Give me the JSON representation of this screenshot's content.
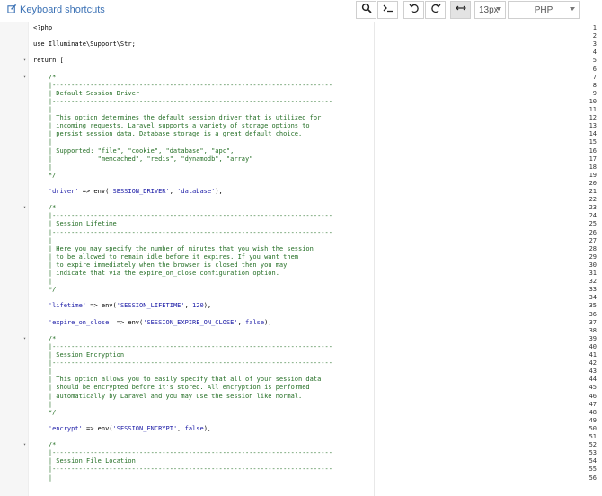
{
  "toolbar": {
    "keyboard_shortcuts": "Keyboard shortcuts",
    "font_size": "13px",
    "mode": "PHP"
  },
  "editor": {
    "lines": [
      {
        "n": "1",
        "text": "<?php",
        "cls": "kw"
      },
      {
        "n": "2",
        "text": "",
        "cls": ""
      },
      {
        "n": "3",
        "text": "use Illuminate\\Support\\Str;",
        "cls": "kw"
      },
      {
        "n": "4",
        "text": "",
        "cls": ""
      },
      {
        "n": "5",
        "text": "return [",
        "cls": "kw",
        "fold": true
      },
      {
        "n": "6",
        "text": "",
        "cls": ""
      },
      {
        "n": "7",
        "text": "    /*",
        "cls": "cmt",
        "fold": true
      },
      {
        "n": "8",
        "text": "    |--------------------------------------------------------------------------",
        "cls": "cmt"
      },
      {
        "n": "9",
        "text": "    | Default Session Driver",
        "cls": "cmt"
      },
      {
        "n": "10",
        "text": "    |--------------------------------------------------------------------------",
        "cls": "cmt"
      },
      {
        "n": "11",
        "text": "    |",
        "cls": "cmt"
      },
      {
        "n": "12",
        "text": "    | This option determines the default session driver that is utilized for",
        "cls": "cmt"
      },
      {
        "n": "13",
        "text": "    | incoming requests. Laravel supports a variety of storage options to",
        "cls": "cmt"
      },
      {
        "n": "14",
        "text": "    | persist session data. Database storage is a great default choice.",
        "cls": "cmt"
      },
      {
        "n": "15",
        "text": "    |",
        "cls": "cmt"
      },
      {
        "n": "16",
        "text": "    | Supported: \"file\", \"cookie\", \"database\", \"apc\",",
        "cls": "cmt"
      },
      {
        "n": "17",
        "text": "    |            \"memcached\", \"redis\", \"dynamodb\", \"array\"",
        "cls": "cmt"
      },
      {
        "n": "18",
        "text": "    |",
        "cls": "cmt"
      },
      {
        "n": "19",
        "text": "    */",
        "cls": "cmt"
      },
      {
        "n": "20",
        "text": "",
        "cls": ""
      },
      {
        "n": "21",
        "text": "    'driver' => env('SESSION_DRIVER', 'database'),",
        "cls": "mix"
      },
      {
        "n": "22",
        "text": "",
        "cls": ""
      },
      {
        "n": "23",
        "text": "    /*",
        "cls": "cmt",
        "fold": true
      },
      {
        "n": "24",
        "text": "    |--------------------------------------------------------------------------",
        "cls": "cmt"
      },
      {
        "n": "25",
        "text": "    | Session Lifetime",
        "cls": "cmt"
      },
      {
        "n": "26",
        "text": "    |--------------------------------------------------------------------------",
        "cls": "cmt"
      },
      {
        "n": "27",
        "text": "    |",
        "cls": "cmt"
      },
      {
        "n": "28",
        "text": "    | Here you may specify the number of minutes that you wish the session",
        "cls": "cmt"
      },
      {
        "n": "29",
        "text": "    | to be allowed to remain idle before it expires. If you want them",
        "cls": "cmt"
      },
      {
        "n": "30",
        "text": "    | to expire immediately when the browser is closed then you may",
        "cls": "cmt"
      },
      {
        "n": "31",
        "text": "    | indicate that via the expire_on_close configuration option.",
        "cls": "cmt"
      },
      {
        "n": "32",
        "text": "    |",
        "cls": "cmt"
      },
      {
        "n": "33",
        "text": "    */",
        "cls": "cmt"
      },
      {
        "n": "34",
        "text": "",
        "cls": ""
      },
      {
        "n": "35",
        "text": "    'lifetime' => env('SESSION_LIFETIME', 120),",
        "cls": "mix"
      },
      {
        "n": "36",
        "text": "",
        "cls": ""
      },
      {
        "n": "37",
        "text": "    'expire_on_close' => env('SESSION_EXPIRE_ON_CLOSE', false),",
        "cls": "mix"
      },
      {
        "n": "38",
        "text": "",
        "cls": ""
      },
      {
        "n": "39",
        "text": "    /*",
        "cls": "cmt",
        "fold": true
      },
      {
        "n": "40",
        "text": "    |--------------------------------------------------------------------------",
        "cls": "cmt"
      },
      {
        "n": "41",
        "text": "    | Session Encryption",
        "cls": "cmt"
      },
      {
        "n": "42",
        "text": "    |--------------------------------------------------------------------------",
        "cls": "cmt"
      },
      {
        "n": "43",
        "text": "    |",
        "cls": "cmt"
      },
      {
        "n": "44",
        "text": "    | This option allows you to easily specify that all of your session data",
        "cls": "cmt"
      },
      {
        "n": "45",
        "text": "    | should be encrypted before it's stored. All encryption is performed",
        "cls": "cmt"
      },
      {
        "n": "46",
        "text": "    | automatically by Laravel and you may use the session like normal.",
        "cls": "cmt"
      },
      {
        "n": "47",
        "text": "    |",
        "cls": "cmt"
      },
      {
        "n": "48",
        "text": "    */",
        "cls": "cmt"
      },
      {
        "n": "49",
        "text": "",
        "cls": ""
      },
      {
        "n": "50",
        "text": "    'encrypt' => env('SESSION_ENCRYPT', false),",
        "cls": "mix"
      },
      {
        "n": "51",
        "text": "",
        "cls": ""
      },
      {
        "n": "52",
        "text": "    /*",
        "cls": "cmt",
        "fold": true
      },
      {
        "n": "53",
        "text": "    |--------------------------------------------------------------------------",
        "cls": "cmt"
      },
      {
        "n": "54",
        "text": "    | Session File Location",
        "cls": "cmt"
      },
      {
        "n": "55",
        "text": "    |--------------------------------------------------------------------------",
        "cls": "cmt"
      },
      {
        "n": "56",
        "text": "    |",
        "cls": "cmt"
      }
    ]
  }
}
